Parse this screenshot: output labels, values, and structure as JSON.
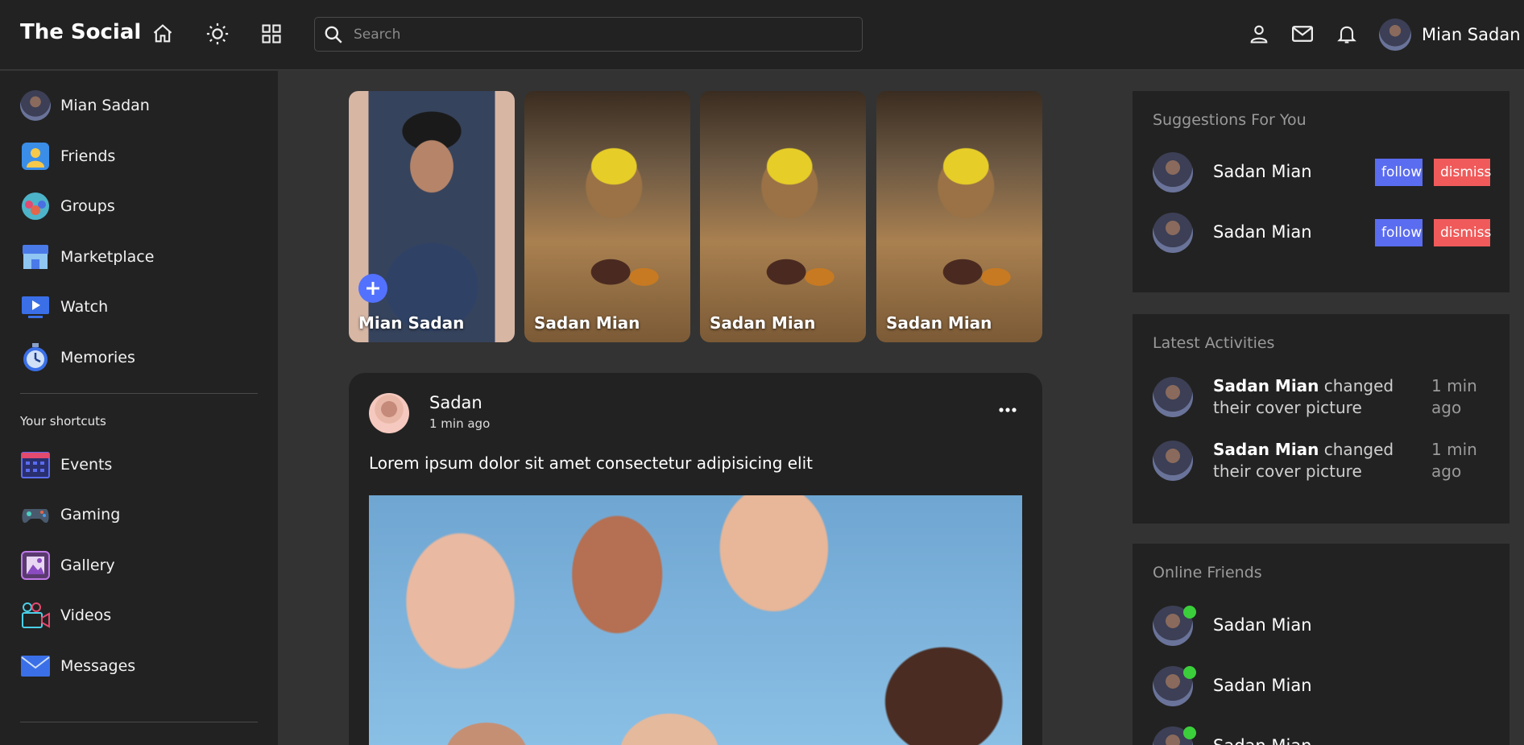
{
  "navbar": {
    "logo": "The Social",
    "search_placeholder": "Search",
    "user_name": "Mian Sadan"
  },
  "sidebar": {
    "user_name": "Mian Sadan",
    "items": [
      {
        "label": "Friends",
        "icon": "friends-icon"
      },
      {
        "label": "Groups",
        "icon": "groups-icon"
      },
      {
        "label": "Marketplace",
        "icon": "marketplace-icon"
      },
      {
        "label": "Watch",
        "icon": "watch-icon"
      },
      {
        "label": "Memories",
        "icon": "memories-icon"
      }
    ],
    "shortcuts_title": "Your shortcuts",
    "shortcuts": [
      {
        "label": "Events",
        "icon": "events-icon"
      },
      {
        "label": "Gaming",
        "icon": "gaming-icon"
      },
      {
        "label": "Gallery",
        "icon": "gallery-icon"
      },
      {
        "label": "Videos",
        "icon": "videos-icon"
      },
      {
        "label": "Messages",
        "icon": "messages-icon"
      }
    ]
  },
  "stories": [
    {
      "name": "Mian Sadan"
    },
    {
      "name": "Sadan Mian"
    },
    {
      "name": "Sadan Mian"
    },
    {
      "name": "Sadan Mian"
    }
  ],
  "post": {
    "user": "Sadan",
    "time": "1 min ago",
    "text": "Lorem ipsum dolor sit amet consectetur adipisicing elit"
  },
  "suggestions": {
    "title": "Suggestions For You",
    "follow_label": "follow",
    "dismiss_label": "dismiss",
    "users": [
      {
        "name": "Sadan Mian"
      },
      {
        "name": "Sadan Mian"
      }
    ]
  },
  "activities": {
    "title": "Latest Activities",
    "items": [
      {
        "name": "Sadan Mian",
        "action": " changed their cover picture",
        "time": "1 min ago"
      },
      {
        "name": "Sadan Mian",
        "action": " changed their cover picture",
        "time": "1 min ago"
      }
    ]
  },
  "online_friends": {
    "title": "Online Friends",
    "users": [
      {
        "name": "Sadan Mian"
      },
      {
        "name": "Sadan Mian"
      },
      {
        "name": "Sadan Mian"
      }
    ]
  },
  "colors": {
    "background": "#333333",
    "panel": "#222222",
    "accent_blue": "#5271ff",
    "follow": "#5a6cf0",
    "dismiss": "#f05a5a",
    "online": "#3ccf3c"
  }
}
